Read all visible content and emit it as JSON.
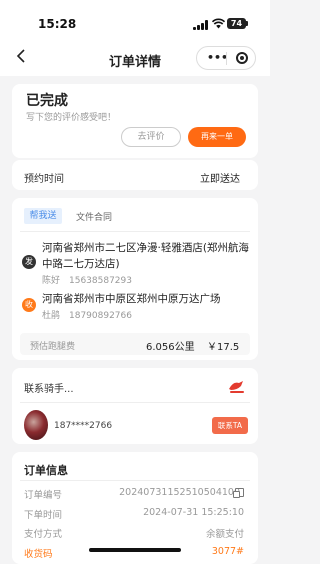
{
  "status_bar": {
    "time": "15:28",
    "battery": "74"
  },
  "nav": {
    "title": "订单详情",
    "more_icon": "more-dots-icon",
    "target_icon": "target-icon"
  },
  "status_card": {
    "status": "已完成",
    "hint": "写下您的评价感受吧！",
    "review_button": "去评价",
    "again_button": "再来一单"
  },
  "reserve": {
    "label": "预约时间",
    "value": "立即送达"
  },
  "route": {
    "service_tag": "帮我送",
    "file_tag": "文件合同",
    "sender": {
      "badge": "发",
      "address": "河南省郑州市二七区净漫·轻雅酒店(郑州航海中路二七万达店)",
      "contact": "陈好　15638587293"
    },
    "receiver": {
      "badge": "收",
      "address": "河南省郑州市中原区郑州中原万达广场",
      "contact": "杜鹃　18790892766"
    },
    "fee": {
      "label": "预估跑腿费",
      "distance": "6.056公里",
      "price": "￥17.5"
    }
  },
  "rider": {
    "title": "联系骑手...",
    "phone": "187****2766",
    "contact_button": "联系TA"
  },
  "order_info": {
    "title": "订单信息",
    "rows": [
      {
        "label": "订单编号",
        "value": "20240731152510504100"
      },
      {
        "label": "下单时间",
        "value": "2024-07-31 15:25:10"
      },
      {
        "label": "支付方式",
        "value": "余额支付"
      }
    ],
    "code_label": "收货码",
    "code_value": "3077#"
  },
  "colors": {
    "accent": "#ff6a13",
    "tag_blue": "#4a8ce8",
    "contact_red": "#f26b4a"
  }
}
